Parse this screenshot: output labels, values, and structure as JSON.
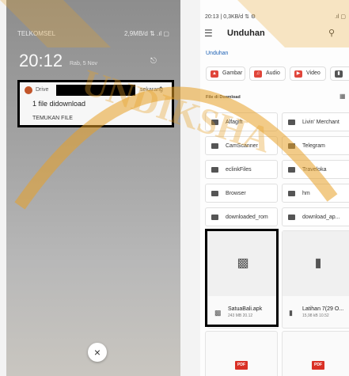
{
  "left": {
    "carrier": "TELKOMSEL",
    "status_right": "2,9MB/d ⇅ .ıl ▢",
    "clock": "20:12",
    "date": "Rab, 5 Nov",
    "notification": {
      "app": "Drive",
      "time": "sekarang",
      "title": "1 file didownload",
      "action": "TEMUKAN FILE"
    },
    "clear_glyph": "×"
  },
  "right": {
    "status_left": "20:13 | 0,3KB/d ⇅ ⚙",
    "status_right": ".ıl ▢",
    "title": "Unduhan",
    "breadcrumb": "Unduhan",
    "chips": [
      {
        "label": "Gambar",
        "color": "#e0453a"
      },
      {
        "label": "Audio",
        "color": "#e0453a"
      },
      {
        "label": "Video",
        "color": "#e0453a"
      },
      {
        "label": "",
        "color": "#555555"
      }
    ],
    "section_label": "File di Download",
    "folders": [
      "Alfagift",
      "Livin' Merchant",
      "CamScanner",
      "Telegram",
      "eclinkFiles",
      "Traveloka",
      "Browser",
      "hm",
      "downloaded_rom",
      "download_ap..."
    ],
    "files": [
      {
        "name": "SatuaBali.apk",
        "meta": "243 MB 20.12"
      },
      {
        "name": "Latihan 7(29 O...",
        "meta": "15,98 kB 10.52"
      }
    ],
    "pdf_badge": "PDF"
  },
  "watermark": {
    "text": "UNDIKSHA",
    "color": "#e7a126"
  }
}
